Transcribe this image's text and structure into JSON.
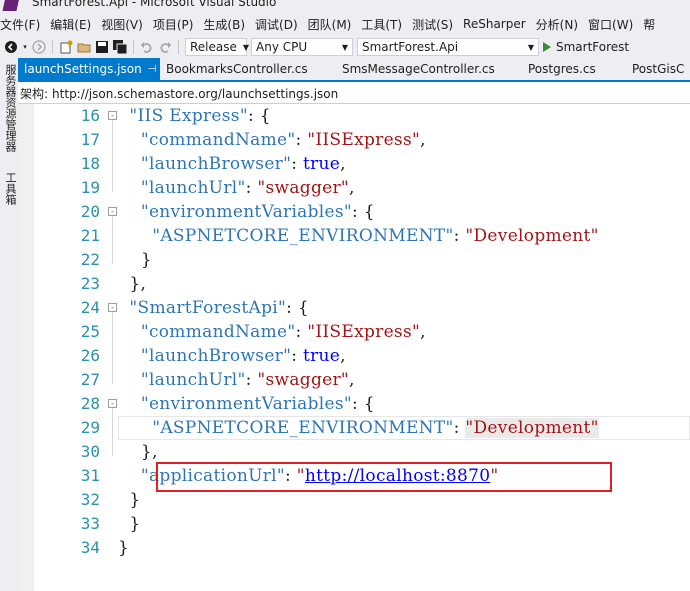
{
  "window": {
    "title": "SmartForest.Api - Microsoft Visual Studio"
  },
  "menu": [
    "文件(F)",
    "编辑(E)",
    "视图(V)",
    "项目(P)",
    "生成(B)",
    "调试(D)",
    "团队(M)",
    "工具(T)",
    "测试(S)",
    "ReSharper",
    "分析(N)",
    "窗口(W)",
    "帮"
  ],
  "toolbar": {
    "configuration": "Release",
    "platform": "Any CPU",
    "startup_project": "SmartForest.Api",
    "run_label": "SmartForest"
  },
  "sidebar": {
    "server_explorer": "服务器资源管理器",
    "toolbox": "工具箱"
  },
  "tabs": [
    {
      "label": "launchSettings.json",
      "active": true
    },
    {
      "label": "BookmarksController.cs"
    },
    {
      "label": "SmsMessageController.cs"
    },
    {
      "label": "Postgres.cs"
    },
    {
      "label": "PostGisC"
    }
  ],
  "schema": {
    "label": "架构:",
    "url": "http://json.schemastore.org/launchsettings.json"
  },
  "lines": [
    {
      "n": "16",
      "fold": "-"
    },
    {
      "n": "17"
    },
    {
      "n": "18"
    },
    {
      "n": "19"
    },
    {
      "n": "20",
      "fold": "-"
    },
    {
      "n": "21"
    },
    {
      "n": "22"
    },
    {
      "n": "23"
    },
    {
      "n": "24",
      "fold": "-"
    },
    {
      "n": "25"
    },
    {
      "n": "26"
    },
    {
      "n": "27"
    },
    {
      "n": "28",
      "fold": "-"
    },
    {
      "n": "29"
    },
    {
      "n": "30"
    },
    {
      "n": "31"
    },
    {
      "n": "32"
    },
    {
      "n": "33"
    },
    {
      "n": "34"
    }
  ],
  "tokens": {
    "iis_express": "\"IIS Express\"",
    "command_name": "\"commandName\"",
    "iis_express_value": "\"IISExpress\"",
    "launch_browser": "\"launchBrowser\"",
    "true_value": "true",
    "launch_url": "\"launchUrl\"",
    "swagger": "\"swagger\"",
    "environment_variables": "\"environmentVariables\"",
    "aspnetcore_environment": "\"ASPNETCORE_ENVIRONMENT\"",
    "development": "\"Development\"",
    "smart_forest_api": "\"SmartForestApi\"",
    "application_url": "\"applicationUrl\"",
    "application_url_value": "http://localhost:8870"
  },
  "colors": {
    "accent": "#007acc",
    "highlight_box": "#e02020",
    "string": "#a31515",
    "key": "#2e75b6",
    "keyword": "#0000ff"
  }
}
